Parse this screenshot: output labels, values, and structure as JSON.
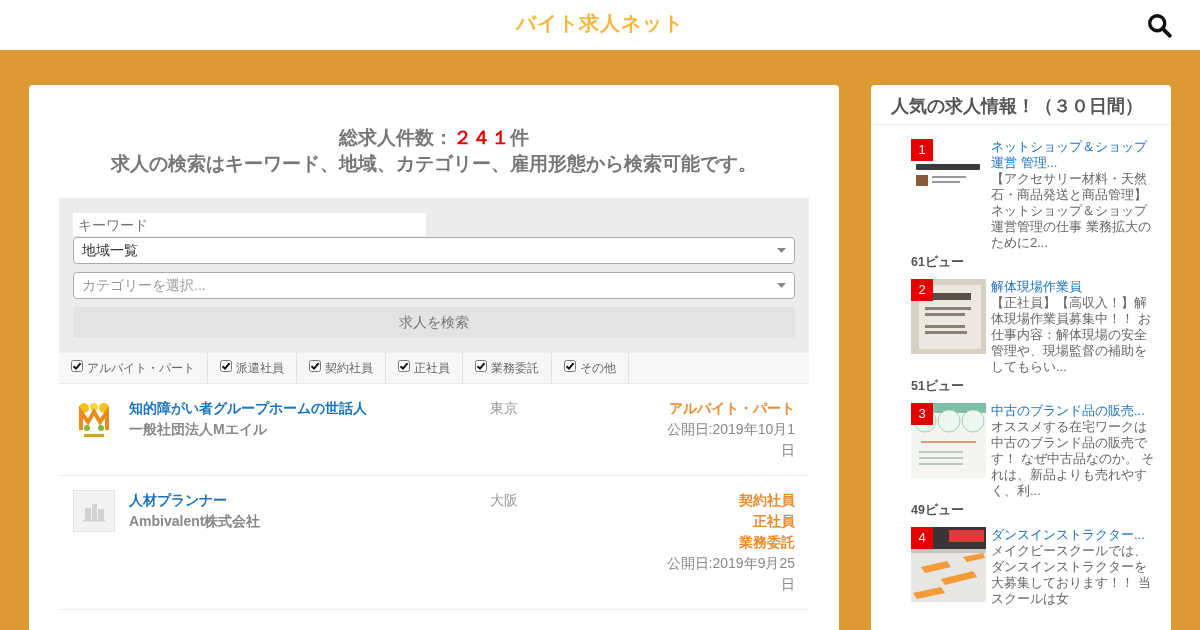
{
  "header": {
    "site_title": "バイト求人ネット"
  },
  "main": {
    "total": {
      "label": "総求人件数：",
      "count": "２４１",
      "unit": "件"
    },
    "description": "求人の検索はキーワード、地域、カテゴリー、雇用形態から検索可能です。",
    "search_form": {
      "keyword": {
        "placeholder": "キーワード"
      },
      "region": {
        "value": "地域一覧"
      },
      "category": {
        "placeholder": "カテゴリーを選択..."
      },
      "submit_button": "求人を検索",
      "employment_types": [
        {
          "label": "アルバイト・パート",
          "checked": true
        },
        {
          "label": "派遣社員",
          "checked": true
        },
        {
          "label": "契約社員",
          "checked": true
        },
        {
          "label": "正社員",
          "checked": true
        },
        {
          "label": "業務委託",
          "checked": true
        },
        {
          "label": "その他",
          "checked": true
        }
      ]
    },
    "jobs": [
      {
        "kind": "logo",
        "title": "知的障がい者グループホームの世話人",
        "company": "一般社団法人Mエイル",
        "location": "東京",
        "employment_types": [
          "アルバイト・パート"
        ],
        "published": "公開日:2019年10月1日"
      },
      {
        "kind": "blank",
        "title": "人材プランナー",
        "company": "Ambivalent株式会社",
        "location": "大阪",
        "employment_types": [
          "契約社員",
          "正社員",
          "業務委託"
        ],
        "published": "公開日:2019年9月25日"
      }
    ]
  },
  "sidebar": {
    "title": "人気の求人情報！（３０日間）",
    "items": [
      {
        "rank": "1",
        "title": "ネットショップ＆ショップ運営 管理...",
        "excerpt": "【アクセサリー材料・天然石・商品発送と商品管理】ネットショップ＆ショップ運営管理の仕事 業務拡大のために2...",
        "views": "61ビュー"
      },
      {
        "rank": "2",
        "title": "解体現場作業員",
        "excerpt": "【正社員】【高収入！】解体現場作業員募集中！！ お仕事内容：解体現場の安全管理や、現場監督の補助をしてもらい...",
        "views": "51ビュー"
      },
      {
        "rank": "3",
        "title": "中古のブランド品の販売...",
        "excerpt": "オススメする在宅ワークは中古のブランド品の販売です！ なぜ中古品なのか。 それは、新品よりも売れやすく、利...",
        "views": "49ビュー"
      },
      {
        "rank": "4",
        "title": "ダンスインストラクター...",
        "excerpt": "メイクビースクールでは、ダンスインストラクターを大募集しております！！ 当スクールは女"
      }
    ]
  }
}
